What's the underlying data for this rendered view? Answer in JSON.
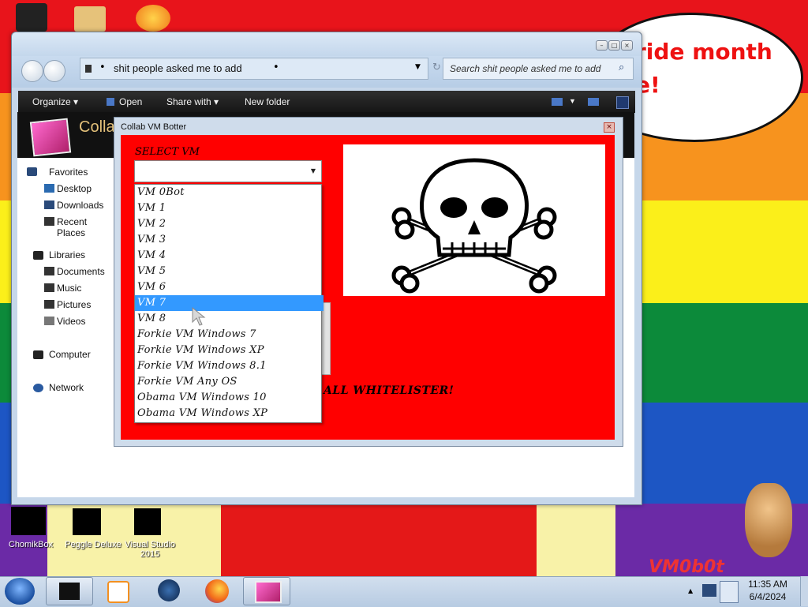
{
  "desktop": {
    "bubble_lines": [
      "ride month",
      "e!"
    ],
    "icons": [
      {
        "label": "ChomikBox"
      },
      {
        "label": "Peggle Deluxe"
      },
      {
        "label": "Visual Studio 2015"
      }
    ],
    "watermark": "VM0b0t"
  },
  "explorer": {
    "path": "shit people asked me to add",
    "search_placeholder": "Search shit people asked me to add",
    "toolbar": {
      "organize": "Organize",
      "open": "Open",
      "share_with": "Share with",
      "new_folder": "New folder"
    },
    "header_partial": "Collab",
    "nav": {
      "favorites": "Favorites",
      "desktop": "Desktop",
      "downloads": "Downloads",
      "recent_places": "Recent Places",
      "libraries": "Libraries",
      "documents": "Documents",
      "music": "Music",
      "pictures": "Pictures",
      "videos": "Videos",
      "computer": "Computer",
      "network": "Network"
    }
  },
  "dialog": {
    "title": "Collab VM Botter",
    "select_label": "SELECT VM",
    "combo_value": "",
    "options": [
      "VM 0Bot",
      "VM 1",
      "VM 2",
      "VM 3",
      "VM 4",
      "VM 5",
      "VM 6",
      "VM 7",
      "VM 8",
      "Forkie VM Windows 7",
      "Forkie VM Windows XP",
      "Forkie VM Windows 8.1",
      "Forkie VM Any OS",
      "Obama VM Windows 10",
      "Obama VM Windows XP"
    ],
    "selected_option": "VM 7",
    "whitelist_text": "ALL WHITELISTER!"
  },
  "taskbar": {
    "time": "11:35 AM",
    "date": "6/4/2024"
  },
  "colors": {
    "dialog_bg": "#ff0000",
    "selection": "#3399ff"
  }
}
